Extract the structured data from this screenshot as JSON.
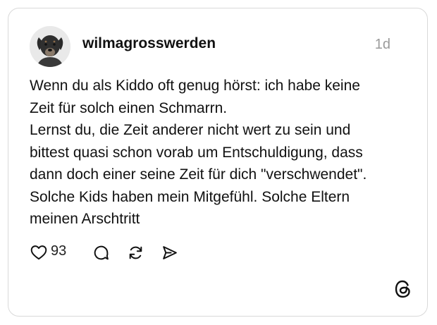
{
  "post": {
    "username": "wilmagrosswerden",
    "time": "1d",
    "text_lines": [
      "Wenn du als Kiddo oft genug hörst: ich habe keine",
      "Zeit für solch einen Schmarrn.",
      "Lernst du, die Zeit anderer nicht wert zu sein und",
      "bittest quasi schon vorab um Entschuldigung, dass",
      "dann doch einer seine Zeit für dich \"verschwendet\".",
      "Solche Kids haben mein Mitgefühl. Solche Eltern",
      "meinen Arschtritt"
    ]
  },
  "actions": {
    "like_count": "93",
    "icons": [
      "heart-icon",
      "comment-icon",
      "repost-icon",
      "share-icon"
    ]
  },
  "branding": {
    "logo_icon": "threads-logo-icon"
  },
  "colors": {
    "border": "#d9d9d9",
    "text": "#111111",
    "muted": "#9a9a9a"
  }
}
